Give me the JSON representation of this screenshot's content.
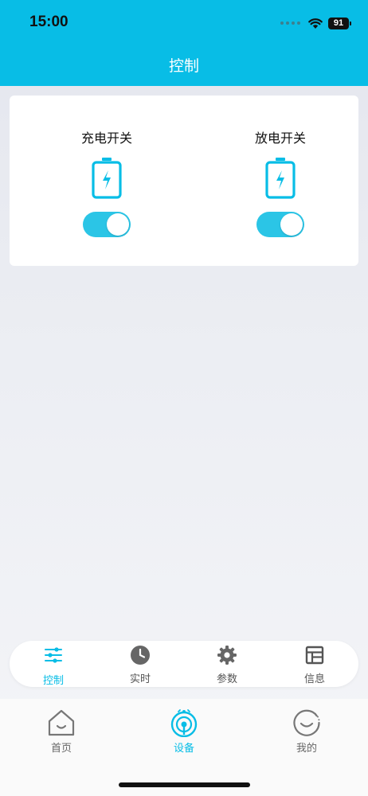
{
  "status_bar": {
    "time": "15:00",
    "battery_level": "91",
    "icons": [
      "signal-dots-icon",
      "wifi-icon",
      "battery-icon"
    ]
  },
  "header": {
    "title": "控制"
  },
  "controls": [
    {
      "label": "充电开关",
      "icon": "battery-charging-icon",
      "enabled": true
    },
    {
      "label": "放电开关",
      "icon": "battery-charging-icon",
      "enabled": true
    }
  ],
  "subtabs": [
    {
      "label": "控制",
      "icon": "sliders-icon",
      "active": true
    },
    {
      "label": "实时",
      "icon": "clock-icon",
      "active": false
    },
    {
      "label": "参数",
      "icon": "gear-icon",
      "active": false
    },
    {
      "label": "信息",
      "icon": "layout-icon",
      "active": false
    }
  ],
  "bottom_nav": [
    {
      "label": "首页",
      "icon": "home-icon",
      "active": false
    },
    {
      "label": "设备",
      "icon": "device-signal-icon",
      "active": true
    },
    {
      "label": "我的",
      "icon": "smile-icon",
      "active": false
    }
  ],
  "colors": {
    "accent": "#08bde6",
    "toggle_on": "#2bc5e6",
    "text": "#111111",
    "inactive": "#666666"
  }
}
